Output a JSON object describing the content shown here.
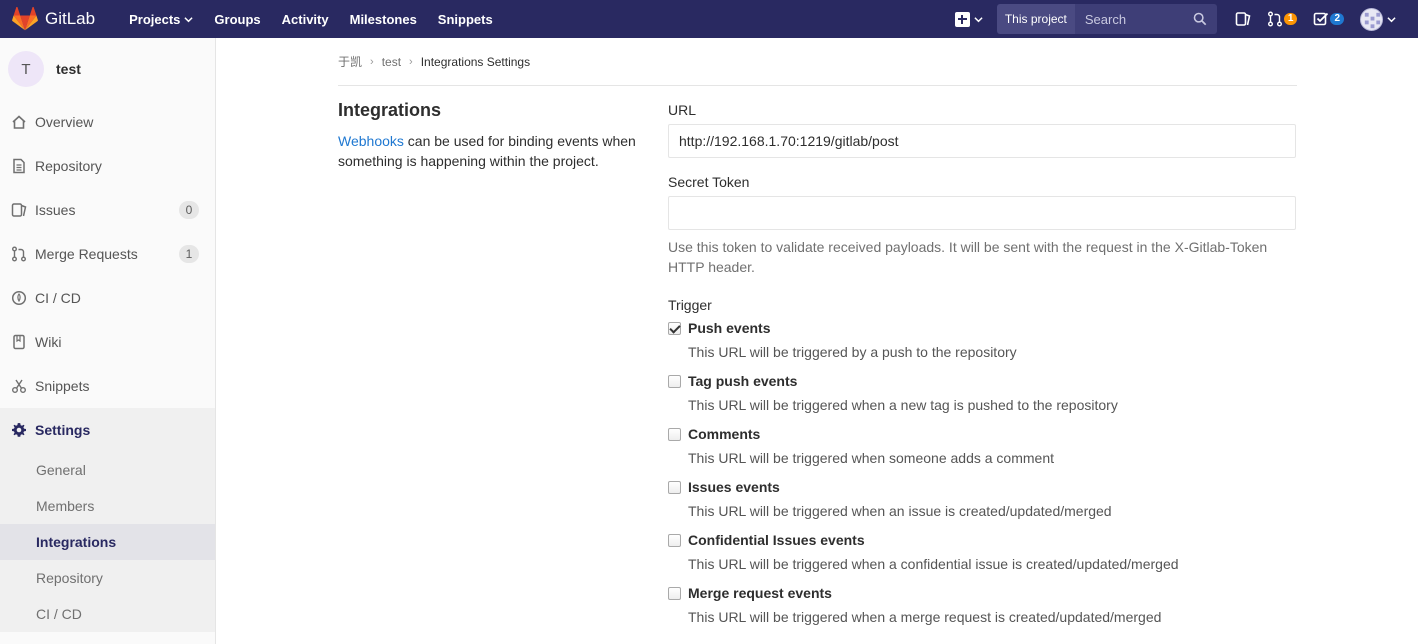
{
  "navbar": {
    "brand": "GitLab",
    "links": [
      "Projects",
      "Groups",
      "Activity",
      "Milestones",
      "Snippets"
    ],
    "scope_label": "This project",
    "search_placeholder": "Search",
    "merge_request_count": "1",
    "todo_count": "2",
    "colors": {
      "background": "#292961",
      "badge_orange": "#fc9403",
      "badge_blue": "#1f78d1"
    }
  },
  "sidebar": {
    "project_initial": "T",
    "project_name": "test",
    "items": [
      {
        "label": "Overview",
        "icon": "home-icon"
      },
      {
        "label": "Repository",
        "icon": "doc-icon"
      },
      {
        "label": "Issues",
        "icon": "issues-icon",
        "count": "0"
      },
      {
        "label": "Merge Requests",
        "icon": "merge-request-icon",
        "count": "1"
      },
      {
        "label": "CI / CD",
        "icon": "rocket-icon"
      },
      {
        "label": "Wiki",
        "icon": "book-icon"
      },
      {
        "label": "Snippets",
        "icon": "scissors-icon"
      }
    ],
    "settings": {
      "label": "Settings",
      "icon": "gear-icon",
      "sub_items": [
        "General",
        "Members",
        "Integrations",
        "Repository",
        "CI / CD"
      ],
      "active": "Integrations"
    }
  },
  "breadcrumb": {
    "items": [
      "于凯",
      "test"
    ],
    "current": "Integrations Settings"
  },
  "integrations": {
    "title": "Integrations",
    "desc_link": "Webhooks",
    "desc_text": " can be used for binding events when something is happening within the project."
  },
  "form": {
    "url_label": "URL",
    "url_value": "http://192.168.1.70:1219/gitlab/post",
    "token_label": "Secret Token",
    "token_value": "",
    "token_help": "Use this token to validate received payloads. It will be sent with the request in the X-Gitlab-Token HTTP header.",
    "trigger_label": "Trigger",
    "triggers": [
      {
        "name": "Push events",
        "checked": true,
        "desc": "This URL will be triggered by a push to the repository"
      },
      {
        "name": "Tag push events",
        "checked": false,
        "desc": "This URL will be triggered when a new tag is pushed to the repository"
      },
      {
        "name": "Comments",
        "checked": false,
        "desc": "This URL will be triggered when someone adds a comment"
      },
      {
        "name": "Issues events",
        "checked": false,
        "desc": "This URL will be triggered when an issue is created/updated/merged"
      },
      {
        "name": "Confidential Issues events",
        "checked": false,
        "desc": "This URL will be triggered when a confidential issue is created/updated/merged"
      },
      {
        "name": "Merge request events",
        "checked": false,
        "desc": "This URL will be triggered when a merge request is created/updated/merged"
      }
    ]
  }
}
